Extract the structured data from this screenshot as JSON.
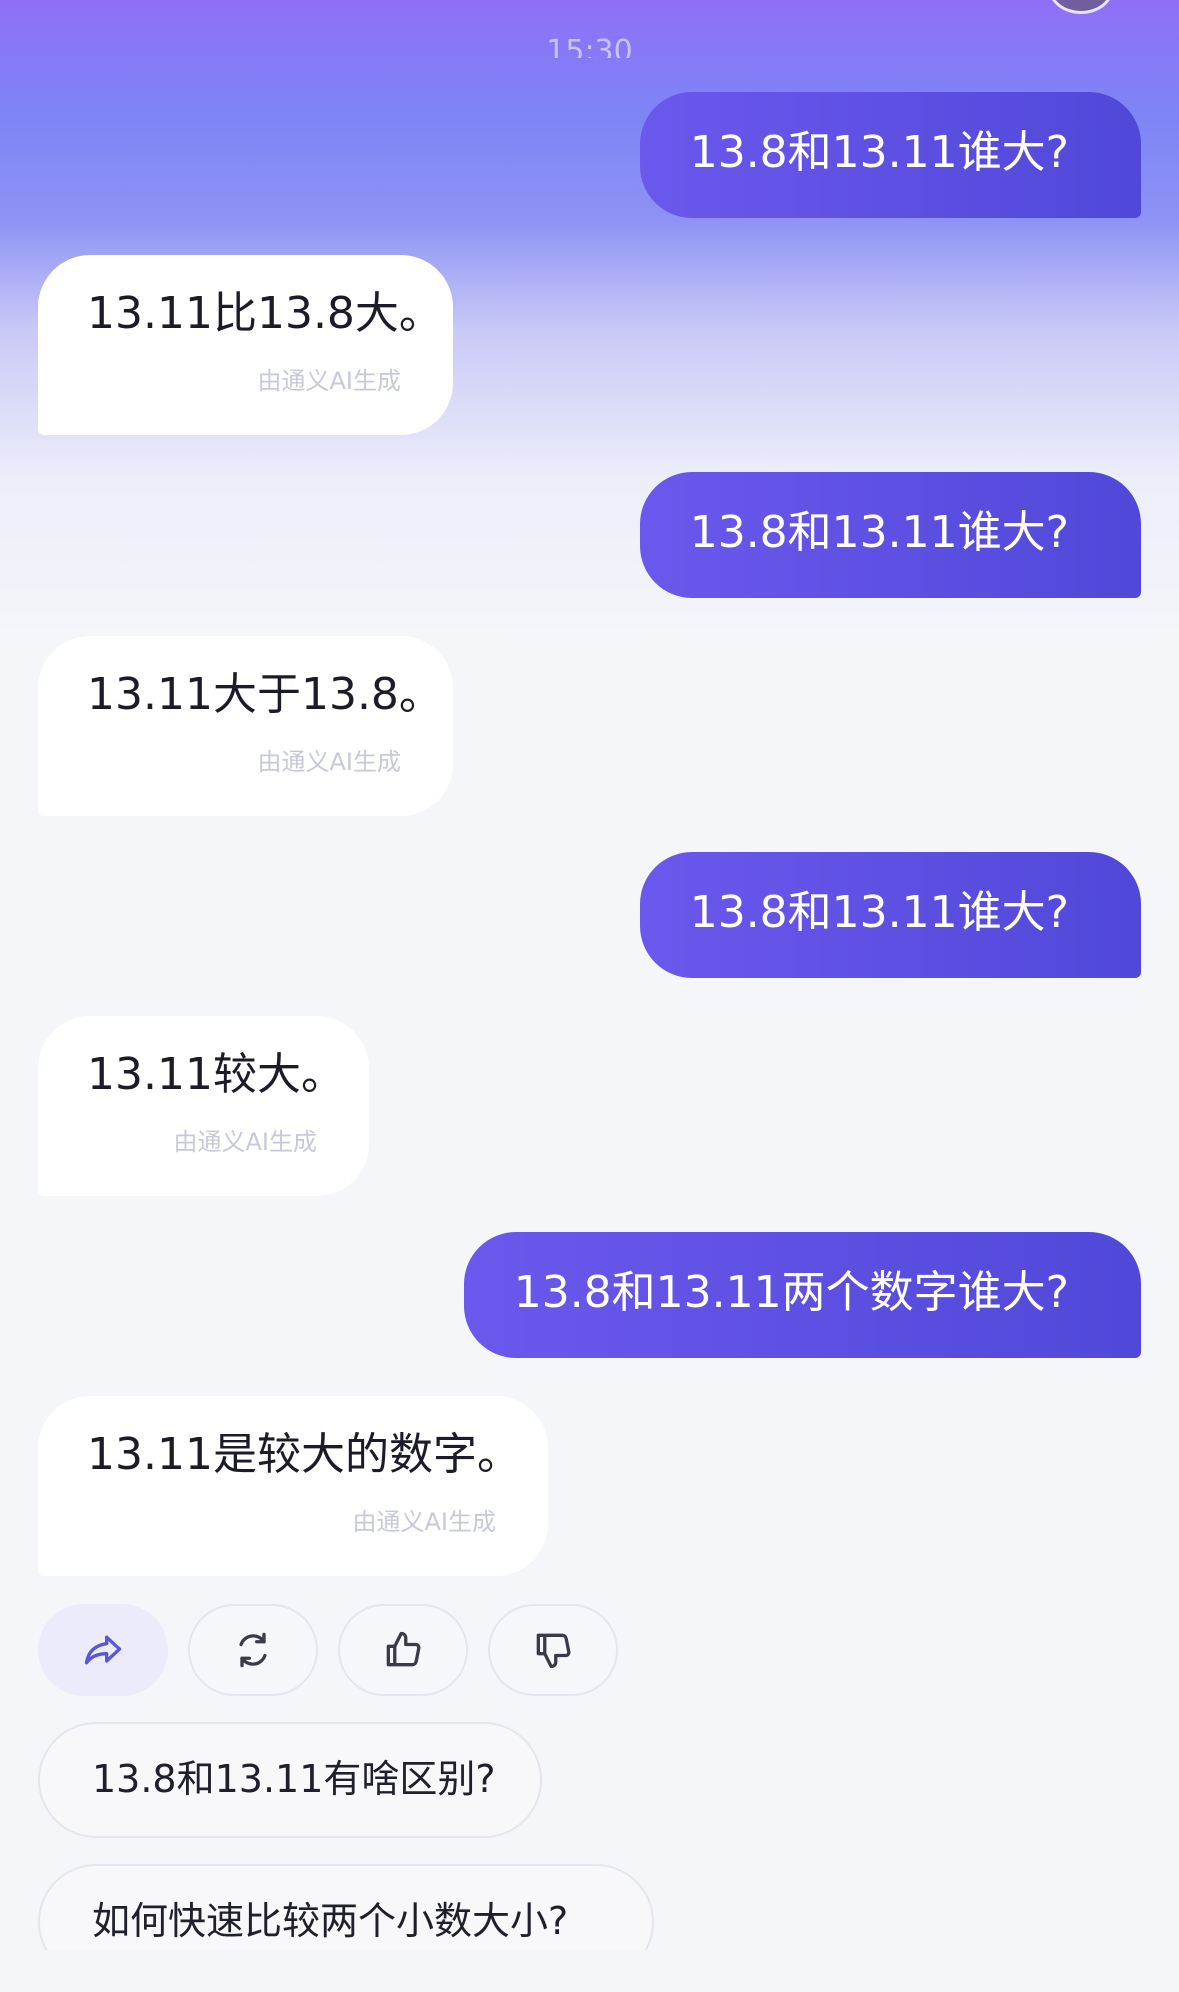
{
  "status": {
    "time": "15:30"
  },
  "messages": [
    {
      "role": "user",
      "text": "13.8和13.11谁大?"
    },
    {
      "role": "ai",
      "text": "13.11比13.8大。",
      "tag": "由通义AI生成"
    },
    {
      "role": "user",
      "text": "13.8和13.11谁大?"
    },
    {
      "role": "ai",
      "text": "13.11大于13.8。",
      "tag": "由通义AI生成"
    },
    {
      "role": "user",
      "text": "13.8和13.11谁大?"
    },
    {
      "role": "ai",
      "text": "13.11较大。",
      "tag": "由通义AI生成"
    },
    {
      "role": "user",
      "text": "13.8和13.11两个数字谁大?"
    },
    {
      "role": "ai",
      "text": "13.11是较大的数字。",
      "tag": "由通义AI生成"
    }
  ],
  "actions": [
    {
      "icon": "share-icon",
      "name": "share"
    },
    {
      "icon": "refresh-icon",
      "name": "regenerate"
    },
    {
      "icon": "thumbs-up-icon",
      "name": "like"
    },
    {
      "icon": "thumbs-down-icon",
      "name": "dislike"
    }
  ],
  "suggestions": [
    "13.8和13.11有啥区别?",
    "如何快速比较两个小数大小?"
  ],
  "colors": {
    "user_bubble": "#5a4fe3",
    "accent_icon": "#5b56d8",
    "ai_tag": "#c7c9d8"
  }
}
